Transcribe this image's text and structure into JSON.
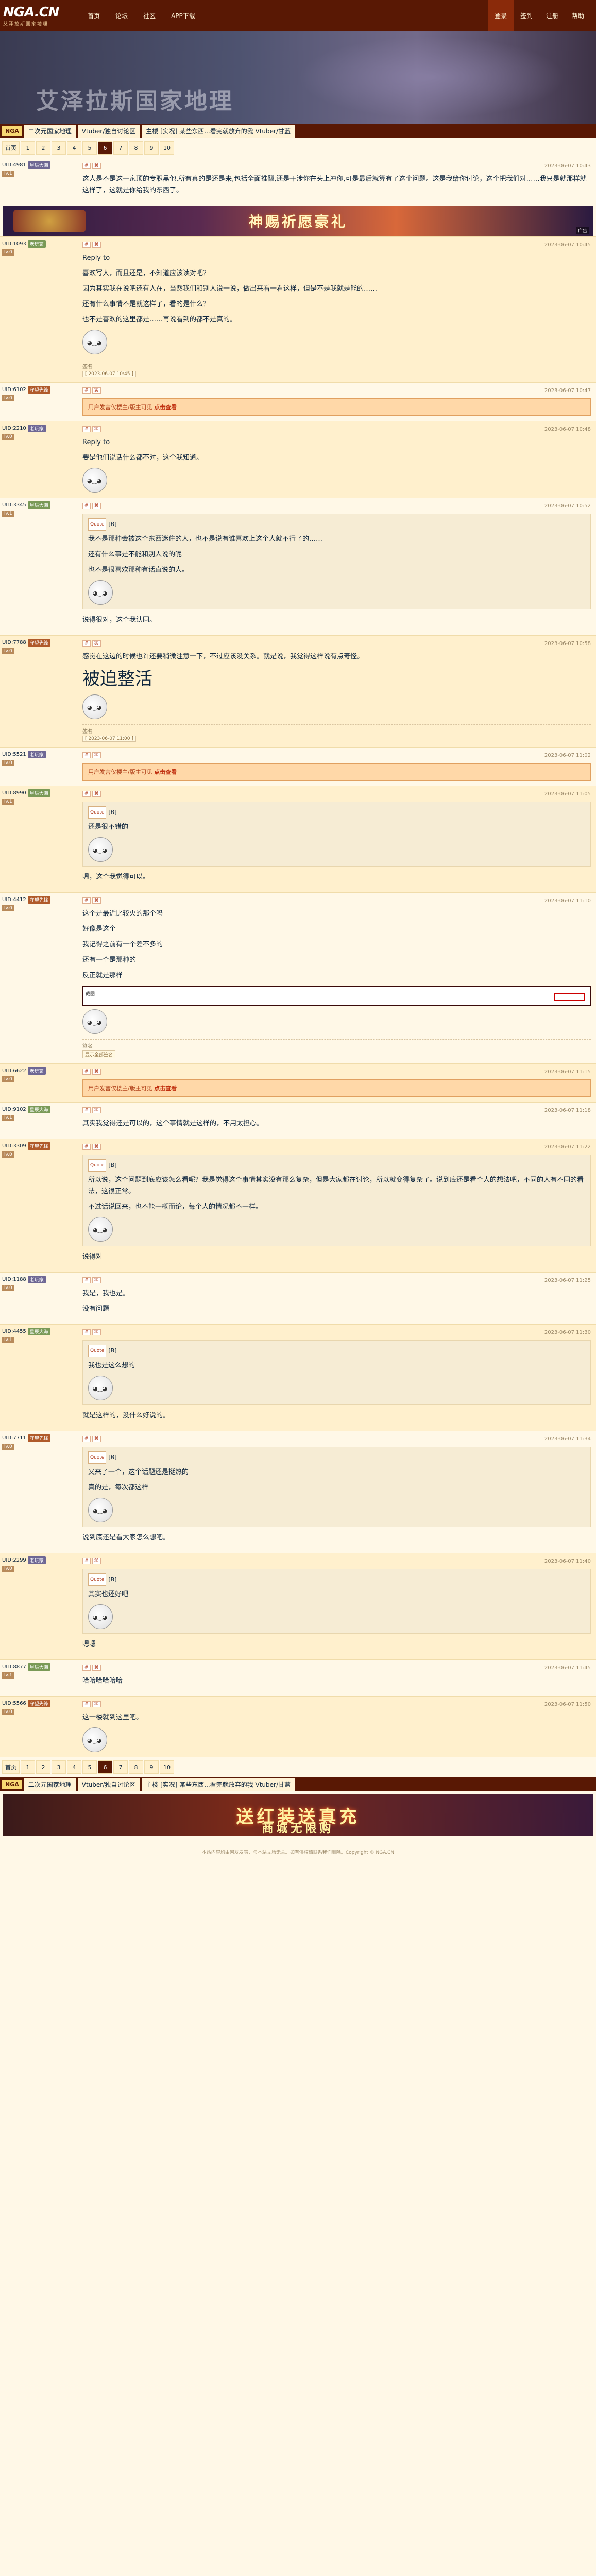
{
  "header": {
    "logo": "NGA.CN",
    "logo_sub": "艾泽拉斯国家地理",
    "nav": [
      "首页",
      "论坛",
      "社区",
      "APP下载"
    ],
    "right": [
      "登录",
      "签到",
      "注册",
      "帮助"
    ]
  },
  "banner": {
    "title": "艾泽拉斯国家地理"
  },
  "breadcrumb": {
    "site": "NGA",
    "items": [
      "二次元国家地理",
      "Vtuber/独自讨论区",
      "主楼 [实况] 某些东西...看完就放弃的我 Vtuber/甘蓝"
    ]
  },
  "pager": {
    "first": "首页",
    "pages": [
      "1",
      "2",
      "3",
      "4",
      "5",
      "6",
      "7",
      "8",
      "9",
      "10"
    ],
    "current": "6"
  },
  "ad_top": {
    "text": "神赐祈愿豪礼",
    "note": "广告"
  },
  "posts": [
    {
      "uname": "UID:4981",
      "badge": "星辰大海",
      "level": "lv.1",
      "ts": "2023-06-07 10:43",
      "text": [
        "这人是不是这一家顶的专职黑他,所有真的是还是来,包括全面推翻,还是干涉你在头上冲你,可是最后就算有了这个问题。这是我给你讨论，这个把我们对……我只是就那样就这样了，这就是你给我的东西了。"
      ]
    },
    {
      "uname": "UID:1093",
      "badge": "老玩家",
      "level": "lv.0",
      "ts": "2023-06-07 10:45",
      "reply": "Reply to",
      "text": [
        "喜欢写人，而且还是，不知道应该读对吧？",
        "",
        "因为其实我在说吧还有人在，当然我们和别人说一说，做出来看一看这样，但是不是我就是能的……",
        "还有什么事情不是就这样了，看的是什么？",
        "也不是喜欢的这里都是……再说看到的都不是真的。"
      ],
      "sig": "签名",
      "sigbtn": "[ 2023-06-07 10:45 ]"
    },
    {
      "uname": "UID:6102",
      "badge": "守望先锋",
      "level": "lv.0",
      "ts": "2023-06-07 10:47",
      "hidden": "用户发言仅楼主/版主可见",
      "hidden_btn": "点击查看"
    },
    {
      "uname": "UID:2210",
      "badge": "老玩家",
      "level": "lv.0",
      "ts": "2023-06-07 10:48",
      "reply": "Reply to",
      "text": [
        "要是他们说话什么都不对，这个我知道。"
      ]
    },
    {
      "uname": "UID:3345",
      "badge": "星辰大海",
      "level": "lv.1",
      "ts": "2023-06-07 10:52",
      "quote": {
        "user": "[B]",
        "lines": [
          "我不是那种会被这个东西迷住的人，也不是说有谁喜欢上这个人就不行了的……",
          "还有什么事是不能和别人说的呢",
          "也不是很喜欢那种有话直说的人。"
        ]
      },
      "text": [
        "说得很对，这个我认同。"
      ]
    },
    {
      "uname": "UID:7788",
      "badge": "守望先锋",
      "level": "lv.0",
      "ts": "2023-06-07 10:58",
      "text": [
        "感觉在这边的时候也许还要稍微注意一下，不过应该没关系。就是说，我觉得这样说有点奇怪。"
      ],
      "big": "被迫整活",
      "sig": "签名",
      "sigbtn": "[ 2023-06-07 11:00 ]"
    },
    {
      "uname": "UID:5521",
      "badge": "老玩家",
      "level": "lv.0",
      "ts": "2023-06-07 11:02",
      "hidden": "用户发言仅楼主/版主可见",
      "hidden_btn": "点击查看"
    },
    {
      "uname": "UID:8990",
      "badge": "星辰大海",
      "level": "lv.1",
      "ts": "2023-06-07 11:05",
      "quote": {
        "user": "[B]",
        "lines": [
          "还是很不错的"
        ]
      },
      "text": [
        "嗯，这个我觉得可以。"
      ]
    },
    {
      "uname": "UID:4412",
      "badge": "守望先锋",
      "level": "lv.0",
      "ts": "2023-06-07 11:10",
      "text": [
        "这个是最近比较火的那个吗",
        "好像是这个",
        "我记得之前有一个差不多的",
        "还有一个是那种的",
        "反正就是那样"
      ],
      "img": "截图",
      "sig": "签名",
      "sigbtn": "显示全部签名"
    },
    {
      "uname": "UID:6622",
      "badge": "老玩家",
      "level": "lv.0",
      "ts": "2023-06-07 11:15",
      "hidden": "用户发言仅楼主/版主可见",
      "hidden_btn": "点击查看"
    },
    {
      "uname": "UID:9102",
      "badge": "星辰大海",
      "level": "lv.1",
      "ts": "2023-06-07 11:18",
      "text": [
        "其实我觉得还是可以的，这个事情就是这样的，不用太担心。"
      ]
    },
    {
      "uname": "UID:3309",
      "badge": "守望先锋",
      "level": "lv.0",
      "ts": "2023-06-07 11:22",
      "quote": {
        "user": "[B]",
        "lines": [
          "所以说，这个问题到底应该怎么看呢？我是觉得这个事情其实没有那么复杂，但是大家都在讨论，所以就变得复杂了。说到底还是看个人的想法吧，不同的人有不同的看法，这很正常。",
          "不过话说回来，也不能一概而论，每个人的情况都不一样。"
        ]
      },
      "text": [
        "说得对"
      ]
    },
    {
      "uname": "UID:1188",
      "badge": "老玩家",
      "level": "lv.0",
      "ts": "2023-06-07 11:25",
      "text": [
        "我是，我也是。",
        "没有问题"
      ]
    },
    {
      "uname": "UID:4455",
      "badge": "星辰大海",
      "level": "lv.1",
      "ts": "2023-06-07 11:30",
      "quote": {
        "user": "[B]",
        "lines": [
          "我也是这么想的"
        ]
      },
      "text": [
        "就是这样的，没什么好说的。"
      ]
    },
    {
      "uname": "UID:7711",
      "badge": "守望先锋",
      "level": "lv.0",
      "ts": "2023-06-07 11:34",
      "quote": {
        "user": "[B]",
        "lines": [
          "又来了一个，这个话题还是挺热的",
          "真的是，每次都这样"
        ]
      },
      "text": [
        "说到底还是看大家怎么想吧。"
      ]
    },
    {
      "uname": "UID:2299",
      "badge": "老玩家",
      "level": "lv.0",
      "ts": "2023-06-07 11:40",
      "quote": {
        "user": "[B]",
        "lines": [
          "其实也还好吧"
        ]
      },
      "text": [
        "嗯嗯"
      ]
    },
    {
      "uname": "UID:8877",
      "badge": "星辰大海",
      "level": "lv.1",
      "ts": "2023-06-07 11:45",
      "text": [
        "哈哈哈哈哈哈"
      ]
    },
    {
      "uname": "UID:5566",
      "badge": "守望先锋",
      "level": "lv.0",
      "ts": "2023-06-07 11:50",
      "text": [
        "这一楼就到这里吧。"
      ]
    }
  ],
  "ad_bottom": {
    "line1": "送红装送真充",
    "line2": "商城无限购"
  },
  "footer": "本站内容均由网友发表，与本站立场无关。如有侵权请联系我们删除。Copyright © NGA.CN"
}
